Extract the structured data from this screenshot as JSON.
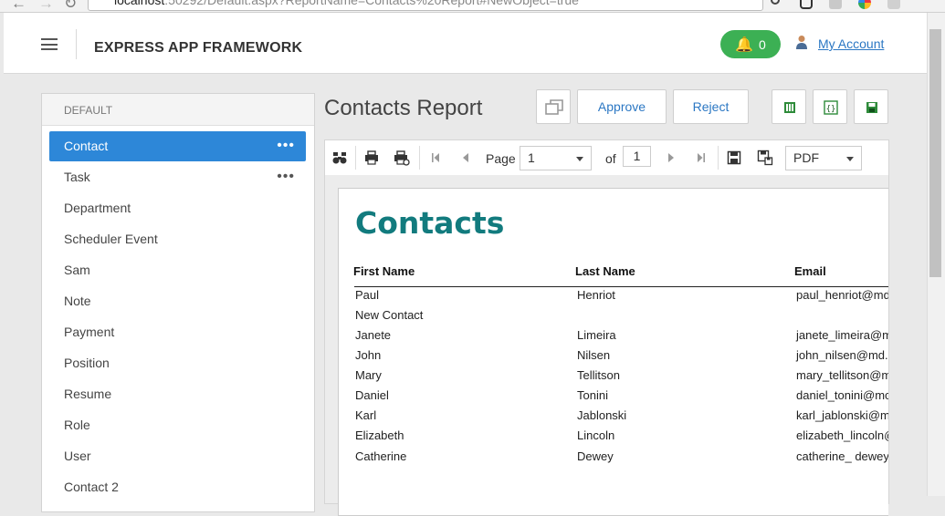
{
  "browser": {
    "url_host": "localhost",
    "url_rest": ":50292/Default.aspx?ReportName=Contacts%20Report#NewObject=true"
  },
  "header": {
    "app_title": "EXPRESS APP FRAMEWORK",
    "notification_count": "0",
    "account_link": "My Account"
  },
  "sidebar": {
    "group": "DEFAULT",
    "items": [
      {
        "label": "Contact",
        "active": true,
        "more": "•••"
      },
      {
        "label": "Task",
        "more": "•••"
      },
      {
        "label": "Department"
      },
      {
        "label": "Scheduler Event"
      },
      {
        "label": "Sam"
      },
      {
        "label": "Note"
      },
      {
        "label": "Payment"
      },
      {
        "label": "Position"
      },
      {
        "label": "Resume"
      },
      {
        "label": "Role"
      },
      {
        "label": "User"
      },
      {
        "label": "Contact 2"
      }
    ]
  },
  "main": {
    "title": "Contacts Report",
    "approve": "Approve",
    "reject": "Reject"
  },
  "viewer": {
    "page_label": "Page",
    "page_value": "1",
    "of_label": "of",
    "page_count": "1",
    "format": "PDF"
  },
  "report": {
    "title": "Contacts",
    "columns": [
      "First Name",
      "Last Name",
      "Email"
    ],
    "rows": [
      [
        "Paul",
        "Henriot",
        "paul_henriot@md"
      ],
      [
        "New Contact",
        "",
        ""
      ],
      [
        "Janete",
        "Limeira",
        "janete_limeira@m"
      ],
      [
        "John",
        "Nilsen",
        "john_nilsen@md.c"
      ],
      [
        "Mary",
        "Tellitson",
        "mary_tellitson@m"
      ],
      [
        "Daniel",
        "Tonini",
        "daniel_tonini@mc"
      ],
      [
        "Karl",
        "Jablonski",
        " karl_jablonski@m"
      ],
      [
        "Elizabeth",
        "Lincoln",
        "elizabeth_lincoln@"
      ],
      [
        "Catherine",
        "Dewey",
        "catherine_ dewey"
      ]
    ]
  },
  "colors": {
    "accent": "#2d87d8",
    "success": "#3cb054",
    "report_title": "#127b7e",
    "link": "#2b77c3"
  }
}
